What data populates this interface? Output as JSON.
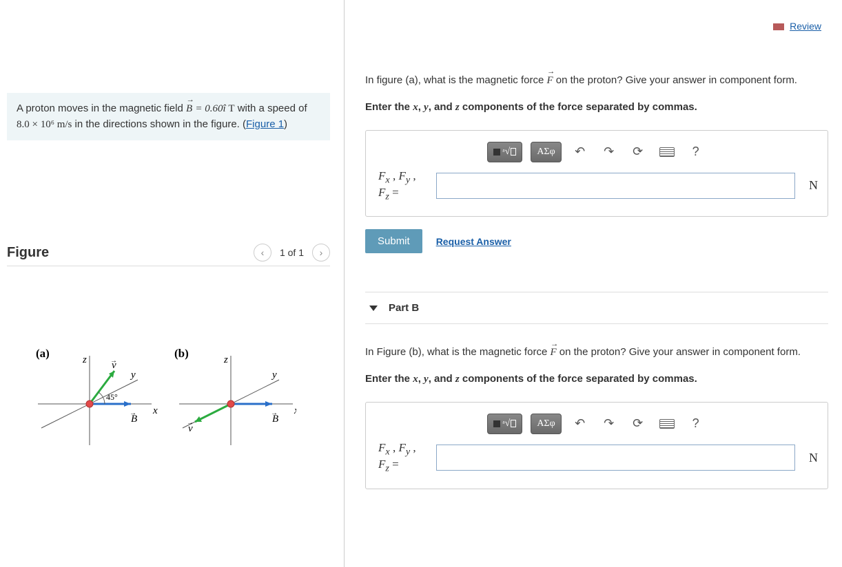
{
  "review": {
    "label": "Review"
  },
  "problem": {
    "prefix": "A proton moves in the magnetic field ",
    "eq_lhs": "B",
    "eq_rhs_val": "0.60",
    "eq_rhs_unit": "T",
    "mid": " with a speed of ",
    "speed": "8.0 × 10⁶ m/s",
    "suffix": " in the directions shown in the figure. (",
    "fig_link": "Figure 1",
    "close": ")"
  },
  "figure": {
    "title": "Figure",
    "page": "1 of 1",
    "labels": {
      "a": "(a)",
      "b": "(b)",
      "x": "x",
      "y": "y",
      "z": "z",
      "v": "v",
      "B": "B",
      "angle": "45°"
    }
  },
  "partA": {
    "q_prefix": "In figure (a), what is the magnetic force ",
    "q_sym": "F",
    "q_suffix": " on the proton? Give your answer in component form.",
    "instr_prefix": "Enter the ",
    "x": "x",
    "y": "y",
    "z": "z",
    "instr_mid1": ", ",
    "instr_and": ", and ",
    "instr_suffix": " components of the force separated by commas.",
    "prefix_line1": "Fₓ , Fᵧ ,",
    "prefix_line2": "F_z =",
    "unit": "N",
    "submit": "Submit",
    "request": "Request Answer"
  },
  "partB": {
    "title": "Part B",
    "q_prefix": "In Figure (b), what is the magnetic force ",
    "q_sym": "F",
    "q_suffix": " on the proton? Give your answer in component form.",
    "instr_prefix": "Enter the ",
    "x": "x",
    "y": "y",
    "z": "z",
    "instr_mid1": ", ",
    "instr_and": ", and ",
    "instr_suffix": " components of the force separated by commas.",
    "prefix_line1": "Fₓ , Fᵧ ,",
    "prefix_line2": "F_z =",
    "unit": "N"
  },
  "toolbar": {
    "templates": "□√□",
    "greek": "ΑΣφ",
    "undo": "↶",
    "redo": "↷",
    "reset": "⟳",
    "help": "?"
  }
}
